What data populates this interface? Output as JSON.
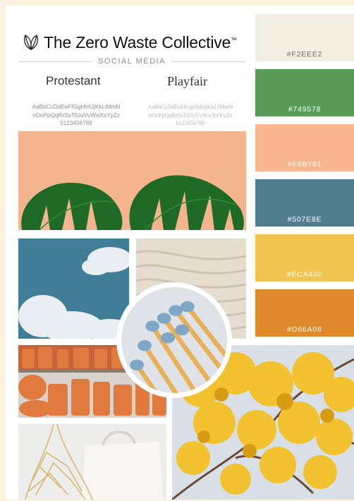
{
  "brand": {
    "name": "The Zero Waste Collective",
    "trademark": "™",
    "logo_icon": "leaf-logo-icon"
  },
  "subtitle": "SOCIAL MEDIA",
  "fonts": [
    {
      "name": "Protestant",
      "specimen": "AaBbCcDdEeFfGgHhIiJjKkLlMmN nOoPpQqRrSsTtUuVvWwXxYyZz 0123456789"
    },
    {
      "name": "Playfair",
      "specimen": "AaBbCcDdEeFfGgHhIiJjKkLlMmN nOoPpQqRrSsTtUuVvWwXxYyZz 0123456789"
    }
  ],
  "palette": [
    {
      "hex": "#F2EEE2",
      "color": "#F2EEE2"
    },
    {
      "hex": "#749578",
      "color": "#5a9a58"
    },
    {
      "hex": "#F8B791",
      "color": "#F8B791"
    },
    {
      "hex": "#507E8E",
      "color": "#507E8E"
    },
    {
      "hex": "#ECA400",
      "color": "#f0c453"
    },
    {
      "hex": "#D66A08",
      "color": "#e08a2e"
    }
  ],
  "photos": [
    "monstera-leaves-photo",
    "blue-sky-clouds-photo",
    "knit-fabric-photo",
    "matches-photo",
    "terracotta-pots-photo",
    "yellow-blossom-tree-photo",
    "tote-bag-photo"
  ]
}
